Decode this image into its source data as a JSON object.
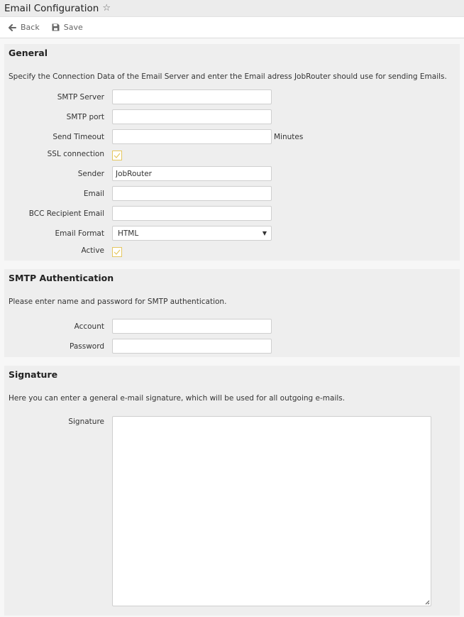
{
  "header": {
    "title": "Email Configuration"
  },
  "toolbar": {
    "back_label": "Back",
    "save_label": "Save"
  },
  "general": {
    "title": "General",
    "description": "Specify the Connection Data of the Email Server and enter the Email adress JobRouter should use for sending Emails.",
    "fields": {
      "smtp_server": {
        "label": "SMTP Server",
        "value": ""
      },
      "smtp_port": {
        "label": "SMTP port",
        "value": ""
      },
      "send_timeout": {
        "label": "Send Timeout",
        "value": "",
        "unit": "Minutes"
      },
      "ssl": {
        "label": "SSL connection",
        "checked": true
      },
      "sender": {
        "label": "Sender",
        "value": "JobRouter"
      },
      "email": {
        "label": "Email",
        "value": ""
      },
      "bcc": {
        "label": "BCC Recipient Email",
        "value": ""
      },
      "format": {
        "label": "Email Format",
        "value": "HTML"
      },
      "active": {
        "label": "Active",
        "checked": true
      }
    }
  },
  "smtp_auth": {
    "title": "SMTP Authentication",
    "description": "Please enter name and password for SMTP authentication.",
    "fields": {
      "account": {
        "label": "Account",
        "value": ""
      },
      "password": {
        "label": "Password",
        "value": ""
      }
    }
  },
  "signature": {
    "title": "Signature",
    "description": "Here you can enter a general e-mail signature, which will be used for all outgoing e-mails.",
    "label": "Signature",
    "value": ""
  },
  "colors": {
    "checkbox_accent": "#e5c760",
    "panel_bg": "#eeeeee"
  }
}
